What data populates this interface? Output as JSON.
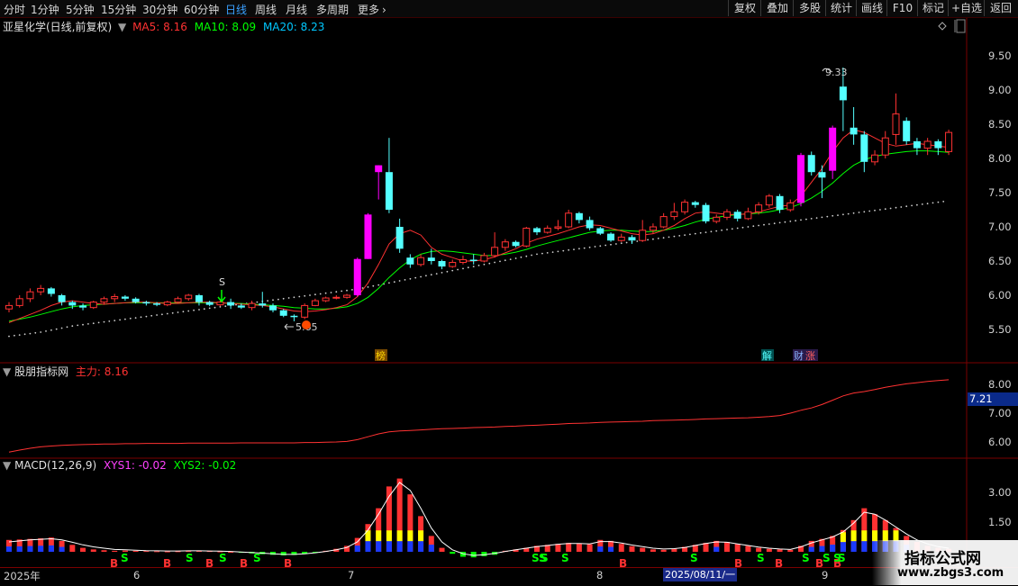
{
  "toolbar": {
    "tabs": [
      "分时",
      "1分钟",
      "5分钟",
      "15分钟",
      "30分钟",
      "60分钟",
      "日线",
      "周线",
      "月线",
      "多周期",
      "更多"
    ],
    "active_tab": "日线",
    "more_arrow": "›",
    "right_buttons": [
      "复权",
      "叠加",
      "多股",
      "统计",
      "画线",
      "F10",
      "标记",
      "+自选",
      "返回"
    ]
  },
  "main_panel": {
    "stock_name": "亚星化学(日线,前复权)",
    "ma5": "MA5: 8.16",
    "ma10": "MA10: 8.09",
    "ma20": "MA20: 8.23",
    "y_ticks": [
      "9.50",
      "9.00",
      "8.50",
      "8.00",
      "7.50",
      "7.00",
      "6.50",
      "6.00",
      "5.50"
    ],
    "high_label": "9.33",
    "low_label": "5.65",
    "signal_s": "S",
    "markers": [
      "榜",
      "解",
      "财",
      "涨"
    ]
  },
  "indicator_panel": {
    "name": "股朋指标网",
    "main_force": "主力: 8.16",
    "y_ticks": [
      "8.00",
      "7.00",
      "6.00"
    ],
    "current_value": "7.21"
  },
  "macd_panel": {
    "name": "MACD(12,26,9)",
    "xys1": "XYS1: -0.02",
    "xys2": "XYS2: -0.02",
    "y_ticks": [
      "3.00",
      "1.50"
    ],
    "signals": [
      "B",
      "S",
      "B",
      "S",
      "B",
      "S",
      "B",
      "S",
      "B",
      "S",
      "S",
      "S",
      "B",
      "S",
      "B",
      "S",
      "B",
      "S",
      "B",
      "S",
      "B",
      "S",
      "S",
      "S"
    ]
  },
  "time_axis": {
    "labels": [
      "2025年",
      "6",
      "7",
      "8",
      "9"
    ],
    "cursor_date": "2025/08/11/一"
  },
  "watermark": {
    "line1": "指标公式网",
    "line2": "www.zbgs3.com"
  },
  "colors": {
    "up": "#ff3232",
    "down": "#54ffff",
    "accent": "#3aa0ff",
    "ma5": "#ff3232",
    "ma10": "#00ff00",
    "ma20": "#00c8ff",
    "limit": "#ff00ff"
  },
  "chart_data": {
    "type": "candlestick",
    "y_range": [
      5.2,
      9.75
    ],
    "candles": [
      [
        5.8,
        5.85,
        5.9,
        5.75
      ],
      [
        5.85,
        5.95,
        6.0,
        5.82
      ],
      [
        5.95,
        6.05,
        6.1,
        5.9
      ],
      [
        6.05,
        6.1,
        6.15,
        6.0
      ],
      [
        6.1,
        6.02,
        6.12,
        5.98
      ],
      [
        6.0,
        5.9,
        6.02,
        5.85
      ],
      [
        5.9,
        5.85,
        5.92,
        5.8
      ],
      [
        5.85,
        5.82,
        5.88,
        5.78
      ],
      [
        5.82,
        5.9,
        5.92,
        5.8
      ],
      [
        5.9,
        5.95,
        5.98,
        5.86
      ],
      [
        5.95,
        5.98,
        6.02,
        5.9
      ],
      [
        5.98,
        5.95,
        6.0,
        5.92
      ],
      [
        5.95,
        5.9,
        5.97,
        5.88
      ],
      [
        5.9,
        5.88,
        5.92,
        5.85
      ],
      [
        5.88,
        5.86,
        5.9,
        5.84
      ],
      [
        5.86,
        5.9,
        5.92,
        5.84
      ],
      [
        5.9,
        5.95,
        5.98,
        5.88
      ],
      [
        5.95,
        6.0,
        6.02,
        5.92
      ],
      [
        6.0,
        5.9,
        6.02,
        5.85
      ],
      [
        5.9,
        5.86,
        5.92,
        5.84
      ],
      [
        5.86,
        5.9,
        5.92,
        5.84
      ],
      [
        5.9,
        5.85,
        5.95,
        5.8
      ],
      [
        5.85,
        5.82,
        5.88,
        5.8
      ],
      [
        5.82,
        5.88,
        5.92,
        5.78
      ],
      [
        5.88,
        5.85,
        6.05,
        5.82
      ],
      [
        5.85,
        5.78,
        5.88,
        5.75
      ],
      [
        5.78,
        5.7,
        5.8,
        5.68
      ],
      [
        5.7,
        5.68,
        5.72,
        5.62
      ],
      [
        5.68,
        5.85,
        5.88,
        5.65
      ],
      [
        5.85,
        5.92,
        5.95,
        5.84
      ],
      [
        5.92,
        5.96,
        5.98,
        5.9
      ],
      [
        5.96,
        5.97,
        6.0,
        5.94
      ],
      [
        5.97,
        6.0,
        6.02,
        5.95
      ],
      [
        6.0,
        6.53,
        6.55,
        5.98
      ],
      [
        6.53,
        7.18,
        7.2,
        6.53
      ],
      [
        7.9,
        7.8,
        7.9,
        7.4
      ],
      [
        7.8,
        7.25,
        8.3,
        7.2
      ],
      [
        7.0,
        6.68,
        7.12,
        6.62
      ],
      [
        6.55,
        6.45,
        6.6,
        6.4
      ],
      [
        6.45,
        6.55,
        6.6,
        6.42
      ],
      [
        6.55,
        6.5,
        6.68,
        6.45
      ],
      [
        6.5,
        6.42,
        6.52,
        6.38
      ],
      [
        6.42,
        6.48,
        6.52,
        6.4
      ],
      [
        6.48,
        6.52,
        6.58,
        6.45
      ],
      [
        6.52,
        6.5,
        6.6,
        6.45
      ],
      [
        6.5,
        6.58,
        6.62,
        6.48
      ],
      [
        6.58,
        6.7,
        6.92,
        6.55
      ],
      [
        6.7,
        6.78,
        6.82,
        6.65
      ],
      [
        6.78,
        6.72,
        6.8,
        6.7
      ],
      [
        6.72,
        6.98,
        7.0,
        6.7
      ],
      [
        6.98,
        6.92,
        7.0,
        6.88
      ],
      [
        6.92,
        6.98,
        7.02,
        6.9
      ],
      [
        6.98,
        7.0,
        7.1,
        6.95
      ],
      [
        7.0,
        7.2,
        7.25,
        6.98
      ],
      [
        7.2,
        7.1,
        7.22,
        7.05
      ],
      [
        7.1,
        6.98,
        7.15,
        6.95
      ],
      [
        6.98,
        6.9,
        7.0,
        6.88
      ],
      [
        6.9,
        6.8,
        6.92,
        6.78
      ],
      [
        6.8,
        6.85,
        6.9,
        6.78
      ],
      [
        6.85,
        6.8,
        6.88,
        6.75
      ],
      [
        6.8,
        6.95,
        7.1,
        6.78
      ],
      [
        6.95,
        7.0,
        7.05,
        6.9
      ],
      [
        7.0,
        7.15,
        7.2,
        6.98
      ],
      [
        7.15,
        7.22,
        7.35,
        7.1
      ],
      [
        7.22,
        7.36,
        7.4,
        7.18
      ],
      [
        7.36,
        7.32,
        7.38,
        7.28
      ],
      [
        7.32,
        7.08,
        7.35,
        7.05
      ],
      [
        7.08,
        7.14,
        7.18,
        7.05
      ],
      [
        7.14,
        7.22,
        7.26,
        7.1
      ],
      [
        7.22,
        7.12,
        7.25,
        7.08
      ],
      [
        7.12,
        7.22,
        7.28,
        7.1
      ],
      [
        7.22,
        7.32,
        7.36,
        7.18
      ],
      [
        7.32,
        7.45,
        7.48,
        7.28
      ],
      [
        7.45,
        7.25,
        7.48,
        7.2
      ],
      [
        7.25,
        7.35,
        7.4,
        7.22
      ],
      [
        7.35,
        8.05,
        8.08,
        7.3
      ],
      [
        8.05,
        7.8,
        8.1,
        7.75
      ],
      [
        7.8,
        7.72,
        7.9,
        7.42
      ],
      [
        7.82,
        8.45,
        8.48,
        7.7
      ],
      [
        9.05,
        8.85,
        9.33,
        8.4
      ],
      [
        8.45,
        8.35,
        8.75,
        8.2
      ],
      [
        8.35,
        7.95,
        8.4,
        7.8
      ],
      [
        7.95,
        8.05,
        8.12,
        7.9
      ],
      [
        8.05,
        8.3,
        8.4,
        8.0
      ],
      [
        8.35,
        8.65,
        8.95,
        8.2
      ],
      [
        8.55,
        8.25,
        8.6,
        8.2
      ],
      [
        8.25,
        8.15,
        8.3,
        8.05
      ],
      [
        8.15,
        8.25,
        8.3,
        8.05
      ],
      [
        8.25,
        8.15,
        8.28,
        8.05
      ],
      [
        8.1,
        8.38,
        8.42,
        8.05
      ]
    ],
    "limit_up_indices": [
      33,
      34,
      35,
      75,
      78
    ],
    "ma5": [
      5.6,
      5.66,
      5.72,
      5.78,
      5.85,
      5.9,
      5.92,
      5.9,
      5.88,
      5.87,
      5.88,
      5.89,
      5.9,
      5.9,
      5.89,
      5.88,
      5.88,
      5.89,
      5.9,
      5.9,
      5.89,
      5.88,
      5.87,
      5.86,
      5.85,
      5.83,
      5.8,
      5.77,
      5.76,
      5.77,
      5.79,
      5.82,
      5.86,
      5.98,
      6.18,
      6.45,
      6.75,
      6.9,
      6.95,
      6.88,
      6.7,
      6.6,
      6.55,
      6.5,
      6.5,
      6.52,
      6.56,
      6.62,
      6.68,
      6.76,
      6.82,
      6.86,
      6.9,
      6.95,
      7.0,
      7.03,
      7.02,
      6.98,
      6.94,
      6.9,
      6.88,
      6.9,
      6.95,
      7.02,
      7.12,
      7.2,
      7.22,
      7.2,
      7.18,
      7.18,
      7.19,
      7.22,
      7.26,
      7.3,
      7.32,
      7.45,
      7.65,
      7.85,
      8.1,
      8.3,
      8.42,
      8.38,
      8.3,
      8.22,
      8.18,
      8.2,
      8.22,
      8.2,
      8.18,
      8.16
    ],
    "ma10": [
      5.62,
      5.65,
      5.68,
      5.72,
      5.76,
      5.8,
      5.83,
      5.85,
      5.86,
      5.87,
      5.88,
      5.89,
      5.89,
      5.89,
      5.89,
      5.89,
      5.89,
      5.89,
      5.89,
      5.89,
      5.89,
      5.88,
      5.88,
      5.87,
      5.86,
      5.85,
      5.84,
      5.82,
      5.81,
      5.8,
      5.8,
      5.81,
      5.83,
      5.88,
      5.97,
      6.1,
      6.26,
      6.4,
      6.52,
      6.6,
      6.64,
      6.65,
      6.64,
      6.62,
      6.6,
      6.58,
      6.58,
      6.6,
      6.63,
      6.67,
      6.72,
      6.76,
      6.8,
      6.84,
      6.88,
      6.92,
      6.94,
      6.95,
      6.95,
      6.94,
      6.93,
      6.93,
      6.95,
      6.98,
      7.02,
      7.07,
      7.11,
      7.14,
      7.16,
      7.18,
      7.19,
      7.2,
      7.22,
      7.25,
      7.28,
      7.34,
      7.42,
      7.52,
      7.64,
      7.78,
      7.9,
      7.98,
      8.03,
      8.06,
      8.08,
      8.1,
      8.11,
      8.11,
      8.1,
      8.09
    ],
    "ma20": [
      5.4,
      5.42,
      5.44,
      5.46,
      5.49,
      5.52,
      5.55,
      5.57,
      5.59,
      5.61,
      5.63,
      5.65,
      5.67,
      5.69,
      5.71,
      5.73,
      5.75,
      5.77,
      5.79,
      5.81,
      5.83,
      5.85,
      5.87,
      5.89,
      5.91,
      5.93,
      5.95,
      5.97,
      5.99,
      6.01,
      6.03,
      6.05,
      6.07,
      6.09,
      6.12,
      6.15,
      6.18,
      6.21,
      6.24,
      6.27,
      6.3,
      6.33,
      6.36,
      6.39,
      6.42,
      6.45,
      6.48,
      6.51,
      6.54,
      6.57,
      6.6,
      6.62,
      6.64,
      6.66,
      6.68,
      6.7,
      6.72,
      6.74,
      6.76,
      6.78,
      6.8,
      6.82,
      6.84,
      6.86,
      6.88,
      6.9,
      6.92,
      6.94,
      6.96,
      6.98,
      7.0,
      7.02,
      7.04,
      7.06,
      7.08,
      7.1,
      7.12,
      7.14,
      7.16,
      7.18,
      7.2,
      7.22,
      7.24,
      7.26,
      7.28,
      7.3,
      7.32,
      7.34,
      7.36,
      7.38
    ],
    "main_force": {
      "y_range": [
        5.5,
        8.6
      ],
      "values": [
        5.65,
        5.72,
        5.78,
        5.83,
        5.86,
        5.88,
        5.9,
        5.91,
        5.92,
        5.93,
        5.93,
        5.94,
        5.94,
        5.95,
        5.95,
        5.95,
        5.95,
        5.96,
        5.96,
        5.96,
        5.96,
        5.96,
        5.97,
        5.97,
        5.97,
        5.97,
        5.97,
        5.97,
        5.98,
        5.98,
        5.99,
        6.0,
        6.02,
        6.08,
        6.18,
        6.28,
        6.35,
        6.38,
        6.4,
        6.42,
        6.44,
        6.46,
        6.47,
        6.48,
        6.5,
        6.51,
        6.52,
        6.54,
        6.55,
        6.57,
        6.58,
        6.6,
        6.62,
        6.64,
        6.65,
        6.66,
        6.68,
        6.69,
        6.7,
        6.71,
        6.72,
        6.74,
        6.75,
        6.76,
        6.77,
        6.78,
        6.8,
        6.81,
        6.82,
        6.83,
        6.84,
        6.86,
        6.88,
        6.92,
        7.0,
        7.1,
        7.18,
        7.3,
        7.45,
        7.6,
        7.7,
        7.75,
        7.82,
        7.9,
        7.96,
        8.02,
        8.06,
        8.1,
        8.13,
        8.16
      ]
    },
    "macd": {
      "y_range": [
        -0.35,
        3.9
      ],
      "hist": [
        0.6,
        0.62,
        0.65,
        0.68,
        0.72,
        0.55,
        0.35,
        0.2,
        0.12,
        0.08,
        0.05,
        0.06,
        0.05,
        0.04,
        0.03,
        0.02,
        0.03,
        0.04,
        0.05,
        0.04,
        0.02,
        0.0,
        -0.05,
        -0.08,
        -0.12,
        -0.15,
        -0.18,
        -0.16,
        -0.1,
        -0.03,
        0.05,
        0.15,
        0.3,
        0.7,
        1.4,
        2.2,
        3.3,
        3.7,
        2.9,
        1.8,
        0.8,
        0.2,
        -0.1,
        -0.25,
        -0.28,
        -0.22,
        -0.15,
        0.05,
        0.12,
        0.2,
        0.3,
        0.35,
        0.4,
        0.45,
        0.42,
        0.38,
        0.6,
        0.55,
        0.4,
        0.28,
        0.2,
        0.12,
        0.1,
        0.15,
        0.25,
        0.35,
        0.45,
        0.55,
        0.5,
        0.4,
        0.3,
        0.2,
        0.15,
        0.12,
        0.1,
        0.3,
        0.55,
        0.65,
        0.8,
        1.1,
        1.6,
        2.2,
        1.9,
        1.6,
        1.2,
        0.8,
        0.5,
        0.3,
        0.2,
        0.15
      ],
      "xys": [
        0.5,
        0.55,
        0.6,
        0.63,
        0.66,
        0.6,
        0.48,
        0.35,
        0.25,
        0.18,
        0.12,
        0.1,
        0.08,
        0.06,
        0.05,
        0.04,
        0.04,
        0.05,
        0.05,
        0.04,
        0.03,
        0.02,
        -0.01,
        -0.04,
        -0.07,
        -0.1,
        -0.13,
        -0.13,
        -0.1,
        -0.05,
        0.02,
        0.1,
        0.22,
        0.5,
        1.1,
        1.9,
        2.8,
        3.5,
        3.1,
        2.2,
        1.2,
        0.5,
        0.1,
        -0.1,
        -0.18,
        -0.15,
        -0.08,
        0.02,
        0.1,
        0.18,
        0.26,
        0.32,
        0.38,
        0.42,
        0.42,
        0.4,
        0.52,
        0.52,
        0.44,
        0.34,
        0.26,
        0.18,
        0.14,
        0.16,
        0.22,
        0.32,
        0.42,
        0.5,
        0.48,
        0.4,
        0.32,
        0.24,
        0.18,
        0.14,
        0.12,
        0.25,
        0.45,
        0.6,
        0.75,
        1.0,
        1.45,
        2.0,
        1.9,
        1.6,
        1.25,
        0.9,
        0.6,
        0.4,
        0.26,
        0.18
      ]
    }
  }
}
